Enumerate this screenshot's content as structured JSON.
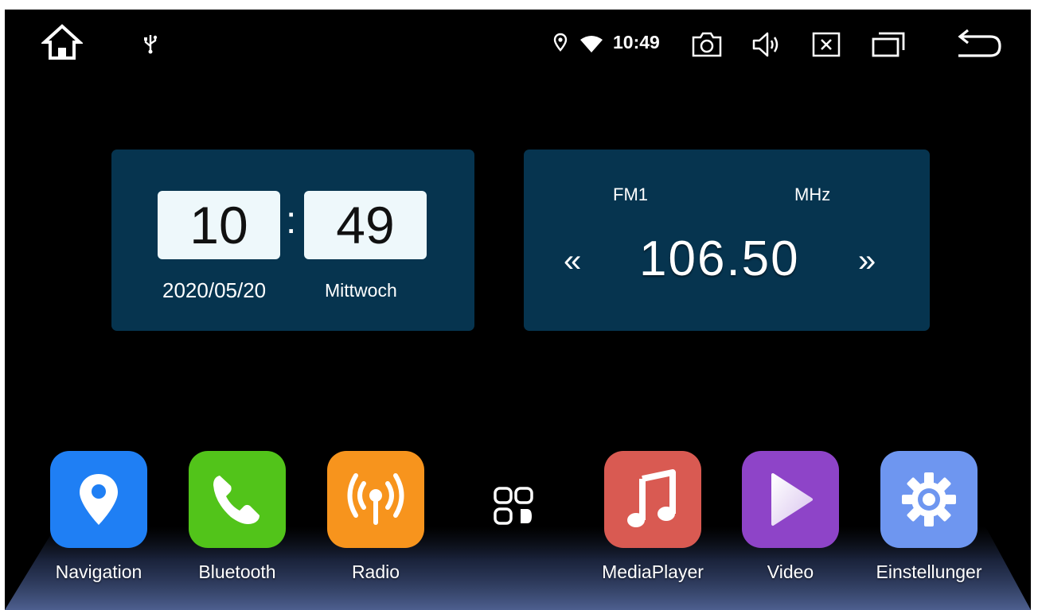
{
  "status_bar": {
    "icons": [
      "home-icon",
      "usb-icon",
      "location-icon",
      "wifi-icon",
      "screenshot-icon",
      "volume-icon",
      "close-app-icon",
      "recent-apps-icon",
      "back-icon"
    ],
    "time": "10:49"
  },
  "clock_widget": {
    "hours": "10",
    "separator": ":",
    "minutes": "49",
    "date": "2020/05/20",
    "weekday": "Mittwoch"
  },
  "radio_widget": {
    "band": "FM1",
    "unit": "MHz",
    "frequency": "106.50",
    "prev_symbol": "«",
    "next_symbol": "»"
  },
  "dock": {
    "apps": [
      {
        "label": "Navigation",
        "icon": "map-pin-icon",
        "color": "#1f7ff4"
      },
      {
        "label": "Bluetooth",
        "icon": "phone-icon",
        "color": "#52c41a"
      },
      {
        "label": "Radio",
        "icon": "radio-antenna-icon",
        "color": "#f7941d"
      },
      {
        "label": "MediaPlayer",
        "icon": "music-note-icon",
        "color": "#d95a52"
      },
      {
        "label": "Video",
        "icon": "play-icon",
        "color": "#8e44c8"
      },
      {
        "label": "Einstellunger",
        "icon": "gear-icon",
        "color": "#6e96f0"
      }
    ],
    "all_apps_icon": "app-grid-icon"
  }
}
